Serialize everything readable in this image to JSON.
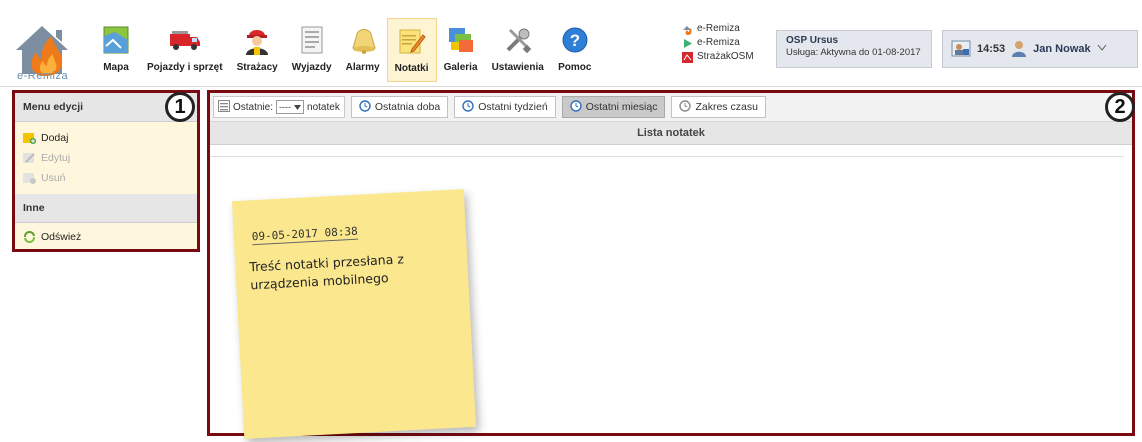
{
  "app": {
    "logo_text": "e-Remiza"
  },
  "nav": [
    {
      "label": "Mapa",
      "icon": "map-icon"
    },
    {
      "label": "Pojazdy i sprzęt",
      "icon": "fire-truck-icon"
    },
    {
      "label": "Strażacy",
      "icon": "firefighter-icon"
    },
    {
      "label": "Wyjazdy",
      "icon": "document-icon"
    },
    {
      "label": "Alarmy",
      "icon": "bell-icon"
    },
    {
      "label": "Notatki",
      "icon": "notepad-icon",
      "active": true
    },
    {
      "label": "Galeria",
      "icon": "gallery-icon"
    },
    {
      "label": "Ustawienia",
      "icon": "tools-icon"
    },
    {
      "label": "Pomoc",
      "icon": "help-icon"
    }
  ],
  "links": [
    "e-Remiza",
    "e-Remiza",
    "StrażakOSM"
  ],
  "org": {
    "name": "OSP Ursus",
    "service": "Usługa: Aktywna do 01-08-2017"
  },
  "user": {
    "time": "14:53",
    "name": "Jan Nowak"
  },
  "sidebar": {
    "edit_header": "Menu edycji",
    "edit_items": [
      {
        "label": "Dodaj",
        "enabled": true
      },
      {
        "label": "Edytuj",
        "enabled": false
      },
      {
        "label": "Usuń",
        "enabled": false
      }
    ],
    "other_header": "Inne",
    "other_items": [
      {
        "label": "Odśwież"
      }
    ]
  },
  "badges": [
    "1",
    "2"
  ],
  "toolbar": {
    "last_label": "Ostatnie:",
    "last_value": "----",
    "notes_label": "notatek",
    "buttons": [
      {
        "label": "Ostatnia doba"
      },
      {
        "label": "Ostatni tydzień"
      },
      {
        "label": "Ostatni miesiąc",
        "active": true
      },
      {
        "label": "Zakres czasu"
      }
    ]
  },
  "list": {
    "title": "Lista notatek"
  },
  "note": {
    "date": "09-05-2017 08:38",
    "text": "Treść notatki przesłana z urządzenia mobilnego"
  },
  "colors": {
    "frame": "#7a0a12",
    "note": "#fbe88e",
    "panel": "#fff7dd"
  }
}
